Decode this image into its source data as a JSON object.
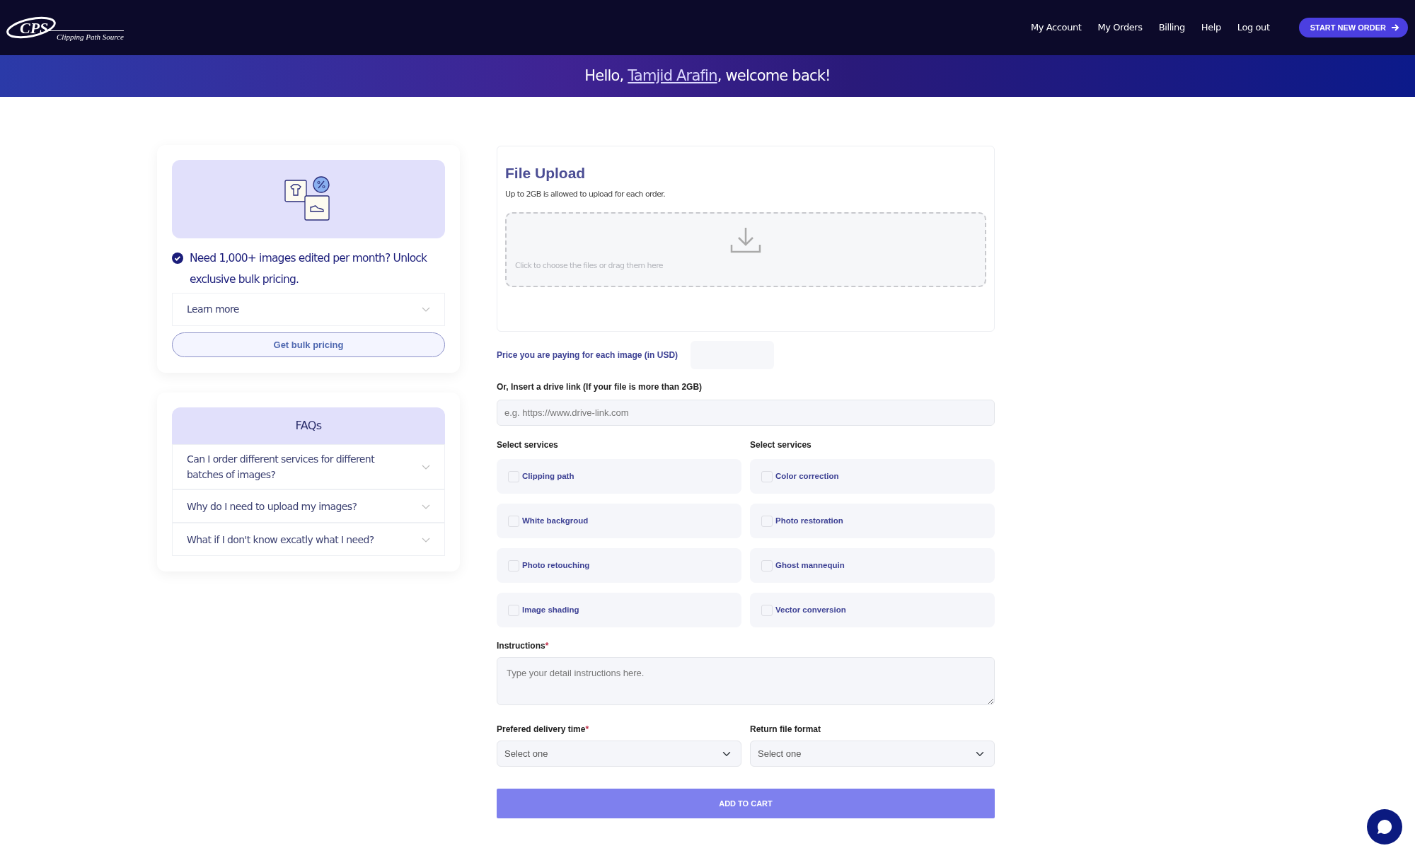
{
  "header": {
    "logo": {
      "mark": "CPS",
      "tagline": "Clipping Path Source"
    },
    "nav": [
      "My Account",
      "My Orders",
      "Billing",
      "Help",
      "Log out"
    ],
    "cta": "START NEW ORDER"
  },
  "greeting": {
    "before": "Hello, ",
    "name": "Tamjid Arafin",
    "after": ", welcome back!"
  },
  "promo": {
    "text": "Need 1,000+ images edited per month? Unlock exclusive bulk pricing.",
    "accordion": {
      "label": "Learn more",
      "expanded": false
    },
    "button": "Get bulk pricing"
  },
  "faqs": {
    "title": "FAQs",
    "items": [
      {
        "question": "Can I order different services for different batches of images?",
        "expanded": false
      },
      {
        "question": "Why do I need to upload my images?",
        "expanded": false
      },
      {
        "question": "What if I don't know excatly what I need?",
        "expanded": false
      }
    ]
  },
  "upload": {
    "title": "File Upload",
    "note": "Up to 2GB is allowed to upload for each order.",
    "dropzone": "Click to choose the files or drag them here"
  },
  "price": {
    "label": "Price you are paying for each image (in USD)"
  },
  "drive": {
    "label": "Or, Insert a drive link (If your file is more than 2GB)",
    "placeholder": "e.g. https://www.drive-link.com"
  },
  "service_columns": [
    {
      "label": "Select services",
      "items": [
        {
          "label": "Clipping path",
          "checked": false
        },
        {
          "label": "White backgroud",
          "checked": false
        },
        {
          "label": "Photo retouching",
          "checked": false
        },
        {
          "label": "Image shading",
          "checked": false
        }
      ]
    },
    {
      "label": "Select services",
      "items": [
        {
          "label": "Color correction",
          "checked": false
        },
        {
          "label": "Photo restoration",
          "checked": false
        },
        {
          "label": "Ghost mannequin",
          "checked": false
        },
        {
          "label": "Vector conversion",
          "checked": false
        }
      ]
    }
  ],
  "instructions": {
    "label": "Instructions",
    "required_mark": "*",
    "placeholder": "Type your detail instructions here."
  },
  "selects": [
    {
      "label": "Prefered delivery time",
      "required_mark": "*",
      "value": "Select one"
    },
    {
      "label": "Return file format",
      "value": "Select one"
    }
  ],
  "submit": "ADD TO CART"
}
